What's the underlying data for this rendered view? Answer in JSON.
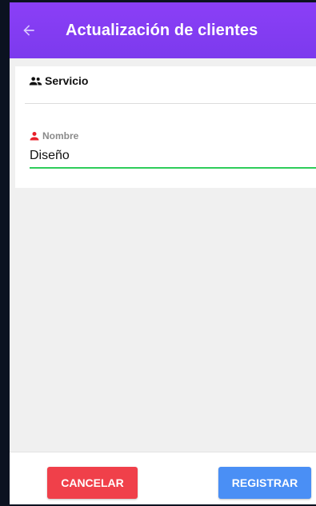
{
  "appbar": {
    "title": "Actualización de clientes",
    "back_icon": "arrow-left-icon",
    "background_color": "#8b3ff7"
  },
  "section": {
    "icon": "group-icon",
    "label": "Servicio"
  },
  "field": {
    "icon": "person-icon",
    "icon_color": "#e8202a",
    "label": "Nombre",
    "value": "Diseño",
    "underline_color": "#2ecc5a"
  },
  "actions": {
    "cancel_label": "CANCELAR",
    "cancel_color": "#f0404a",
    "register_label": "REGISTRAR",
    "register_color": "#4a8ff5"
  }
}
